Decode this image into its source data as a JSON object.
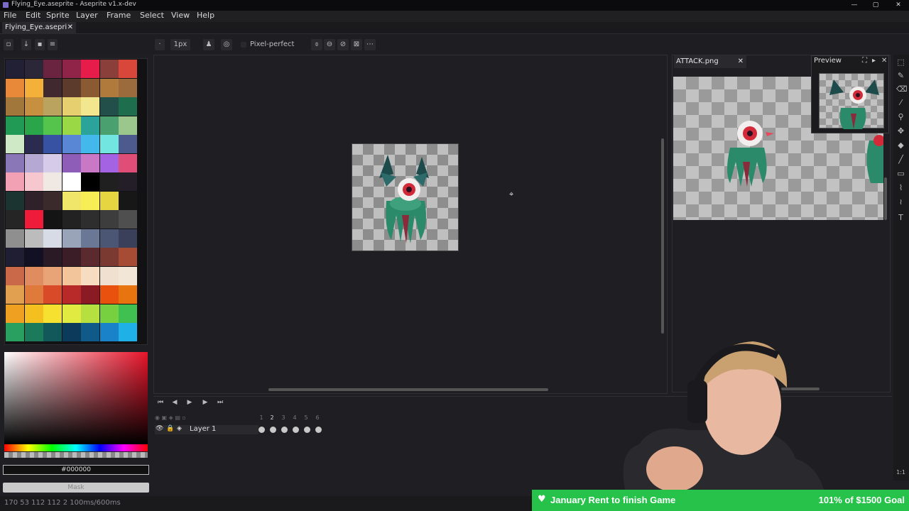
{
  "window": {
    "title": "Flying_Eye.aseprite - Aseprite v1.x-dev",
    "min": "—",
    "max": "▢",
    "close": "✕"
  },
  "menu": [
    "File",
    "Edit",
    "Sprite",
    "Layer",
    "Frame",
    "Select",
    "View",
    "Help"
  ],
  "tabs": {
    "doc": "Flying_Eye.asepri",
    "attack": "ATTACK.png"
  },
  "toolbar": {
    "brush_size": "1px",
    "pixel_perfect": "Pixel-perfect"
  },
  "palette": {
    "colors": [
      "#222034",
      "#2b2638",
      "#6a2440",
      "#8f2348",
      "#e61c4b",
      "#8a3f3a",
      "#d9473b",
      "#e8893a",
      "#f4b13a",
      "#402a30",
      "#5c3a2c",
      "#8a5a32",
      "#b07a3c",
      "#9b6b3e",
      "#a2773c",
      "#c69040",
      "#b9a35e",
      "#e6cf6e",
      "#f2e78e",
      "#234f4a",
      "#1e6d4c",
      "#209a55",
      "#2aa54a",
      "#55c44c",
      "#9bd846",
      "#2ba39a",
      "#4aa06e",
      "#9cc78c",
      "#cfe9c7",
      "#2a2b4e",
      "#3852a3",
      "#5a86d6",
      "#42b9ea",
      "#73e5e1",
      "#4d5a8d",
      "#8a77b8",
      "#b5a9d3",
      "#d6cbe8",
      "#8e5db7",
      "#c978c6",
      "#a463e3",
      "#e04d76",
      "#f2a0b4",
      "#f7c7cf",
      "#efe8e3",
      "#ffffff",
      "#000000",
      "#202020",
      "#241e28",
      "#1b3431",
      "#2e2128",
      "#3a2a2c",
      "#f0e76a",
      "#f6ee54",
      "#e6d440",
      "#171717",
      "#252525",
      "#ee1c3a",
      "#141414",
      "#222222",
      "#2e2e2e",
      "#3d3d3d",
      "#4f4f4f",
      "#8f8f8f",
      "#bcbcbc",
      "#d7dbe6",
      "#9aa4b9",
      "#6b7895",
      "#4b5674",
      "#3a3f5a",
      "#201e33",
      "#121124",
      "#2a1a26",
      "#3b1d28",
      "#5a2a2e",
      "#7a3a32",
      "#a64b34",
      "#c9694a",
      "#e08c60",
      "#e8a476",
      "#f3c59a",
      "#f6dcc0",
      "#f0e0d0",
      "#f2e7d7",
      "#e0a050",
      "#e07a3a",
      "#d84a28",
      "#b82a2a",
      "#8a1a24",
      "#e8520e",
      "#e87410",
      "#f0a020",
      "#f4c020",
      "#f6e030",
      "#e0ea40",
      "#b6e040",
      "#76d040",
      "#40c050",
      "#2aa060",
      "#1a7a5a",
      "#12585a",
      "#0c3a5a",
      "#105a8a",
      "#1a82c8",
      "#20b0e8"
    ]
  },
  "color_hex": "#000000",
  "mask_label": "Mask",
  "editor2": {
    "preview_title": "Preview"
  },
  "timeline": {
    "layer_name": "Layer 1",
    "frames": [
      "1",
      "2",
      "3",
      "4",
      "5",
      "6"
    ]
  },
  "status": {
    "text": "170 53   112 112   2   100ms/600ms"
  },
  "overlay": {
    "goal_left": "January Rent to finish Game",
    "goal_right": "101% of $1500 Goal"
  }
}
